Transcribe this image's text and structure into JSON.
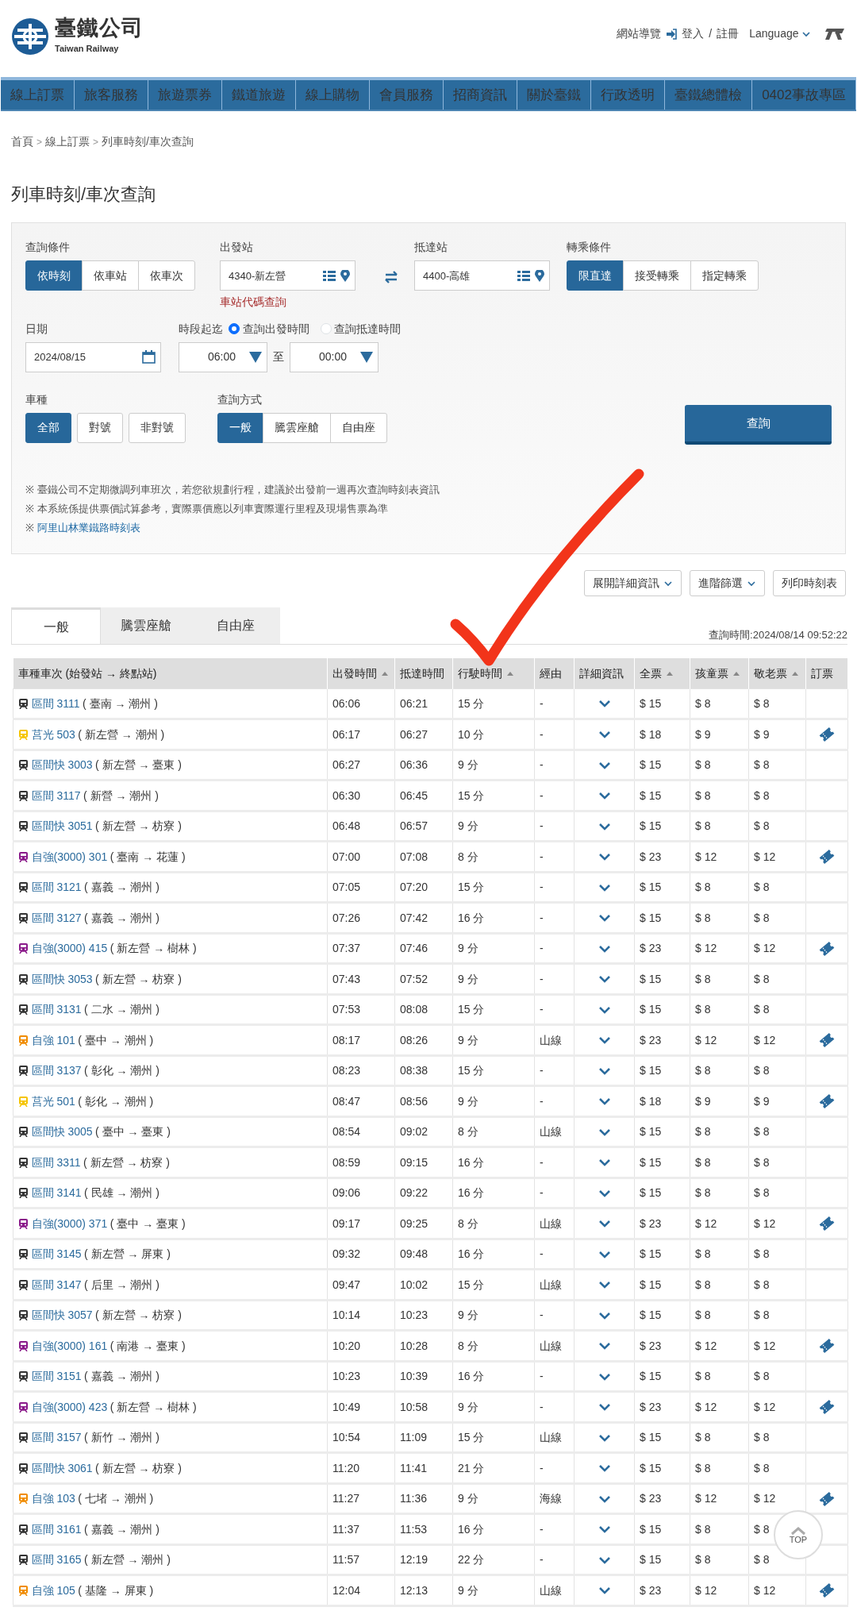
{
  "header": {
    "logo_title": "臺鐵公司",
    "logo_subtitle": "Taiwan Railway",
    "utility_links": [
      {
        "label": "網站導覽",
        "kind": "link"
      },
      {
        "label": "登入",
        "kind": "login"
      },
      {
        "label": "/",
        "kind": "separator"
      },
      {
        "label": "註冊",
        "kind": "link"
      },
      {
        "label": "Language",
        "kind": "dropdown"
      }
    ]
  },
  "main_nav": [
    "線上訂票",
    "旅客服務",
    "旅遊票券",
    "鐵道旅遊",
    "線上購物",
    "會員服務",
    "招商資訊",
    "關於臺鐵",
    "行政透明",
    "臺鐵總體檢",
    "0402事故專區"
  ],
  "breadcrumb": {
    "separator": ">",
    "items": [
      "首頁",
      "線上訂票",
      "列車時刻/車次查詢"
    ]
  },
  "page_title": "列車時刻/車次查詢",
  "form": {
    "query_mode": {
      "label": "查詢條件",
      "options": [
        {
          "label": "依時刻",
          "selected": true
        },
        {
          "label": "依車站",
          "selected": false
        },
        {
          "label": "依車次",
          "selected": false
        }
      ]
    },
    "departure": {
      "label": "出發站",
      "value": "4340-新左營",
      "help_link": "車站代碼查詢"
    },
    "arrival": {
      "label": "抵達站",
      "value": "4400-高雄"
    },
    "transfer": {
      "label": "轉乘條件",
      "options": [
        {
          "label": "限直達",
          "selected": true
        },
        {
          "label": "接受轉乘",
          "selected": false
        },
        {
          "label": "指定轉乘",
          "selected": false
        }
      ]
    },
    "date": {
      "label": "日期",
      "value": "2024/08/15"
    },
    "time_range": {
      "label": "時段起迄",
      "radios": [
        {
          "label": "查詢出發時間",
          "selected": true
        },
        {
          "label": "查詢抵達時間",
          "selected": false
        }
      ],
      "from": "06:00",
      "separator": "至",
      "to": "00:00"
    },
    "train_type": {
      "label": "車種",
      "options": [
        {
          "label": "全部",
          "selected": true
        },
        {
          "label": "對號",
          "selected": false
        },
        {
          "label": "非對號",
          "selected": false
        }
      ]
    },
    "seat_mode": {
      "label": "查詢方式",
      "options": [
        {
          "label": "一般",
          "selected": true
        },
        {
          "label": "騰雲座艙",
          "selected": false
        },
        {
          "label": "自由座",
          "selected": false
        }
      ]
    },
    "submit": "查詢",
    "note_marker": "※",
    "notes": [
      {
        "kind": "text",
        "text": "臺鐵公司不定期微調列車班次，若您欲規劃行程，建議於出發前一週再次查詢時刻表資訊"
      },
      {
        "kind": "text",
        "text": "本系統係提供票價試算參考，實際票價應以列車實際運行里程及現場售票為準"
      },
      {
        "kind": "link",
        "text": "阿里山林業鐵路時刻表"
      }
    ]
  },
  "toolbar": [
    {
      "label": "展開詳細資訊",
      "dropdown": true
    },
    {
      "label": "進階篩選",
      "dropdown": true
    },
    {
      "label": "列印時刻表",
      "dropdown": false
    }
  ],
  "result_tabs": [
    {
      "label": "一般",
      "selected": true
    },
    {
      "label": "騰雲座艙",
      "selected": false
    },
    {
      "label": "自由座",
      "selected": false
    }
  ],
  "query_time": "查詢時間:2024/08/14 09:52:22",
  "table": {
    "columns": [
      {
        "label": "車種車次 (始發站 → 終點站)",
        "sortable": false
      },
      {
        "label": "出發時間",
        "sortable": true
      },
      {
        "label": "抵達時間",
        "sortable": false
      },
      {
        "label": "行駛時間",
        "sortable": true
      },
      {
        "label": "經由",
        "sortable": false
      },
      {
        "label": "詳細資訊",
        "sortable": false
      },
      {
        "label": "全票",
        "sortable": true
      },
      {
        "label": "孩童票",
        "sortable": true
      },
      {
        "label": "敬老票",
        "sortable": true
      },
      {
        "label": "訂票",
        "sortable": false
      }
    ],
    "rows": [
      {
        "train": "區間 3111",
        "route": "( 臺南 → 潮州 )",
        "color": "#333333",
        "depart": "06:06",
        "arrive": "06:21",
        "duration": "15 分",
        "via": "-",
        "adult": "$ 15",
        "child": "$ 8",
        "senior": "$ 8",
        "bookable": false
      },
      {
        "train": "莒光 503",
        "route": "( 新左營 → 潮州 )",
        "color": "#f5c400",
        "depart": "06:17",
        "arrive": "06:27",
        "duration": "10 分",
        "via": "-",
        "adult": "$ 18",
        "child": "$ 9",
        "senior": "$ 9",
        "bookable": true
      },
      {
        "train": "區間快 3003",
        "route": "( 新左營 → 臺東 )",
        "color": "#333333",
        "depart": "06:27",
        "arrive": "06:36",
        "duration": "9 分",
        "via": "-",
        "adult": "$ 15",
        "child": "$ 8",
        "senior": "$ 8",
        "bookable": false
      },
      {
        "train": "區間 3117",
        "route": "( 新營 → 潮州 )",
        "color": "#333333",
        "depart": "06:30",
        "arrive": "06:45",
        "duration": "15 分",
        "via": "-",
        "adult": "$ 15",
        "child": "$ 8",
        "senior": "$ 8",
        "bookable": false
      },
      {
        "train": "區間快 3051",
        "route": "( 新左營 → 枋寮 )",
        "color": "#333333",
        "depart": "06:48",
        "arrive": "06:57",
        "duration": "9 分",
        "via": "-",
        "adult": "$ 15",
        "child": "$ 8",
        "senior": "$ 8",
        "bookable": false
      },
      {
        "train": "自強(3000) 301",
        "route": "( 臺南 → 花蓮 )",
        "color": "#8a1a8a",
        "depart": "07:00",
        "arrive": "07:08",
        "duration": "8 分",
        "via": "-",
        "adult": "$ 23",
        "child": "$ 12",
        "senior": "$ 12",
        "bookable": true
      },
      {
        "train": "區間 3121",
        "route": "( 嘉義 → 潮州 )",
        "color": "#333333",
        "depart": "07:05",
        "arrive": "07:20",
        "duration": "15 分",
        "via": "-",
        "adult": "$ 15",
        "child": "$ 8",
        "senior": "$ 8",
        "bookable": false
      },
      {
        "train": "區間 3127",
        "route": "( 嘉義 → 潮州 )",
        "color": "#333333",
        "depart": "07:26",
        "arrive": "07:42",
        "duration": "16 分",
        "via": "-",
        "adult": "$ 15",
        "child": "$ 8",
        "senior": "$ 8",
        "bookable": false
      },
      {
        "train": "自強(3000) 415",
        "route": "( 新左營 → 樹林 )",
        "color": "#8a1a8a",
        "depart": "07:37",
        "arrive": "07:46",
        "duration": "9 分",
        "via": "-",
        "adult": "$ 23",
        "child": "$ 12",
        "senior": "$ 12",
        "bookable": true
      },
      {
        "train": "區間快 3053",
        "route": "( 新左營 → 枋寮 )",
        "color": "#333333",
        "depart": "07:43",
        "arrive": "07:52",
        "duration": "9 分",
        "via": "-",
        "adult": "$ 15",
        "child": "$ 8",
        "senior": "$ 8",
        "bookable": false
      },
      {
        "train": "區間 3131",
        "route": "( 二水 → 潮州 )",
        "color": "#333333",
        "depart": "07:53",
        "arrive": "08:08",
        "duration": "15 分",
        "via": "-",
        "adult": "$ 15",
        "child": "$ 8",
        "senior": "$ 8",
        "bookable": false
      },
      {
        "train": "自強 101",
        "route": "( 臺中 → 潮州 )",
        "color": "#f08c00",
        "depart": "08:17",
        "arrive": "08:26",
        "duration": "9 分",
        "via": "山線",
        "adult": "$ 23",
        "child": "$ 12",
        "senior": "$ 12",
        "bookable": true
      },
      {
        "train": "區間 3137",
        "route": "( 彰化 → 潮州 )",
        "color": "#333333",
        "depart": "08:23",
        "arrive": "08:38",
        "duration": "15 分",
        "via": "-",
        "adult": "$ 15",
        "child": "$ 8",
        "senior": "$ 8",
        "bookable": false
      },
      {
        "train": "莒光 501",
        "route": "( 彰化 → 潮州 )",
        "color": "#f5c400",
        "depart": "08:47",
        "arrive": "08:56",
        "duration": "9 分",
        "via": "-",
        "adult": "$ 18",
        "child": "$ 9",
        "senior": "$ 9",
        "bookable": true
      },
      {
        "train": "區間快 3005",
        "route": "( 臺中 → 臺東 )",
        "color": "#333333",
        "depart": "08:54",
        "arrive": "09:02",
        "duration": "8 分",
        "via": "山線",
        "adult": "$ 15",
        "child": "$ 8",
        "senior": "$ 8",
        "bookable": false
      },
      {
        "train": "區間 3311",
        "route": "( 新左營 → 枋寮 )",
        "color": "#333333",
        "depart": "08:59",
        "arrive": "09:15",
        "duration": "16 分",
        "via": "-",
        "adult": "$ 15",
        "child": "$ 8",
        "senior": "$ 8",
        "bookable": false
      },
      {
        "train": "區間 3141",
        "route": "( 民雄 → 潮州 )",
        "color": "#333333",
        "depart": "09:06",
        "arrive": "09:22",
        "duration": "16 分",
        "via": "-",
        "adult": "$ 15",
        "child": "$ 8",
        "senior": "$ 8",
        "bookable": false
      },
      {
        "train": "自強(3000) 371",
        "route": "( 臺中 → 臺東 )",
        "color": "#8a1a8a",
        "depart": "09:17",
        "arrive": "09:25",
        "duration": "8 分",
        "via": "山線",
        "adult": "$ 23",
        "child": "$ 12",
        "senior": "$ 12",
        "bookable": true
      },
      {
        "train": "區間 3145",
        "route": "( 新左營 → 屏東 )",
        "color": "#333333",
        "depart": "09:32",
        "arrive": "09:48",
        "duration": "16 分",
        "via": "-",
        "adult": "$ 15",
        "child": "$ 8",
        "senior": "$ 8",
        "bookable": false
      },
      {
        "train": "區間 3147",
        "route": "( 后里 → 潮州 )",
        "color": "#333333",
        "depart": "09:47",
        "arrive": "10:02",
        "duration": "15 分",
        "via": "山線",
        "adult": "$ 15",
        "child": "$ 8",
        "senior": "$ 8",
        "bookable": false
      },
      {
        "train": "區間快 3057",
        "route": "( 新左營 → 枋寮 )",
        "color": "#333333",
        "depart": "10:14",
        "arrive": "10:23",
        "duration": "9 分",
        "via": "-",
        "adult": "$ 15",
        "child": "$ 8",
        "senior": "$ 8",
        "bookable": false
      },
      {
        "train": "自強(3000) 161",
        "route": "( 南港 → 臺東 )",
        "color": "#8a1a8a",
        "depart": "10:20",
        "arrive": "10:28",
        "duration": "8 分",
        "via": "山線",
        "adult": "$ 23",
        "child": "$ 12",
        "senior": "$ 12",
        "bookable": true
      },
      {
        "train": "區間 3151",
        "route": "( 嘉義 → 潮州 )",
        "color": "#333333",
        "depart": "10:23",
        "arrive": "10:39",
        "duration": "16 分",
        "via": "-",
        "adult": "$ 15",
        "child": "$ 8",
        "senior": "$ 8",
        "bookable": false
      },
      {
        "train": "自強(3000) 423",
        "route": "( 新左營 → 樹林 )",
        "color": "#8a1a8a",
        "depart": "10:49",
        "arrive": "10:58",
        "duration": "9 分",
        "via": "-",
        "adult": "$ 23",
        "child": "$ 12",
        "senior": "$ 12",
        "bookable": true
      },
      {
        "train": "區間 3157",
        "route": "( 新竹 → 潮州 )",
        "color": "#333333",
        "depart": "10:54",
        "arrive": "11:09",
        "duration": "15 分",
        "via": "山線",
        "adult": "$ 15",
        "child": "$ 8",
        "senior": "$ 8",
        "bookable": false
      },
      {
        "train": "區間快 3061",
        "route": "( 新左營 → 枋寮 )",
        "color": "#333333",
        "depart": "11:20",
        "arrive": "11:41",
        "duration": "21 分",
        "via": "-",
        "adult": "$ 15",
        "child": "$ 8",
        "senior": "$ 8",
        "bookable": false
      },
      {
        "train": "自強 103",
        "route": "( 七堵 → 潮州 )",
        "color": "#f08c00",
        "depart": "11:27",
        "arrive": "11:36",
        "duration": "9 分",
        "via": "海線",
        "adult": "$ 23",
        "child": "$ 12",
        "senior": "$ 12",
        "bookable": true
      },
      {
        "train": "區間 3161",
        "route": "( 嘉義 → 潮州 )",
        "color": "#333333",
        "depart": "11:37",
        "arrive": "11:53",
        "duration": "16 分",
        "via": "-",
        "adult": "$ 15",
        "child": "$ 8",
        "senior": "$ 8",
        "bookable": false
      },
      {
        "train": "區間 3165",
        "route": "( 新左營 → 潮州 )",
        "color": "#333333",
        "depart": "11:57",
        "arrive": "12:19",
        "duration": "22 分",
        "via": "-",
        "adult": "$ 15",
        "child": "$ 8",
        "senior": "$ 8",
        "bookable": false
      },
      {
        "train": "自強 105",
        "route": "( 基隆 → 屏東 )",
        "color": "#f08c00",
        "depart": "12:04",
        "arrive": "12:13",
        "duration": "9 分",
        "via": "山線",
        "adult": "$ 23",
        "child": "$ 12",
        "senior": "$ 12",
        "bookable": true
      }
    ]
  },
  "back_to_top": "TOP",
  "annotation": {
    "kind": "checkmark"
  }
}
